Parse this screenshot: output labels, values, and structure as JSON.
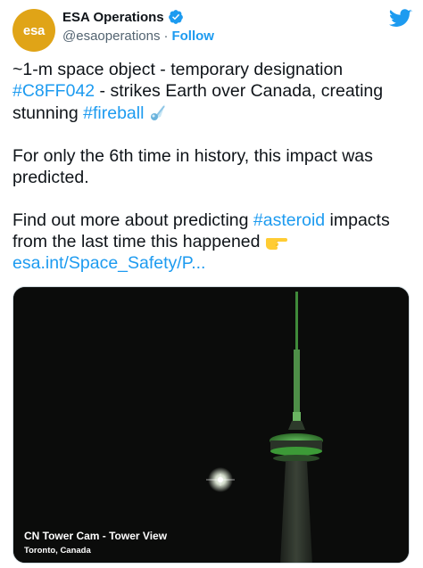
{
  "account": {
    "name": "ESA Operations",
    "handle": "@esaoperations",
    "separator": "·",
    "follow_label": "Follow",
    "avatar_text": "esa"
  },
  "tweet": {
    "line1_text": "~1-m space object - temporary designation",
    "hashtag_designation": "#C8FF042",
    "line2_text": " - strikes Earth over Canada, creating",
    "line3_text": "stunning ",
    "hashtag_fireball": "#fireball",
    "paragraph2": "For only the 6th time in history, this impact was predicted.",
    "para3_text": "Find out more about predicting ",
    "hashtag_asteroid": "#asteroid",
    "para3_text2": " impacts",
    "para3_line2": "from the last time this happened ",
    "link_text": "esa.int/Space_Safety/P..."
  },
  "media": {
    "caption_title": "CN Tower Cam - Tower View",
    "caption_location": "Toronto, Canada"
  },
  "colors": {
    "link": "#1d9bf0",
    "avatar_bg": "#e0a417",
    "tower_glow": "#4fa84a"
  },
  "icons": {
    "verified": "verified-badge-icon",
    "twitter": "twitter-bird-icon",
    "comet": "comet-emoji-icon",
    "pointing_hand": "pointing-hand-emoji-icon"
  }
}
